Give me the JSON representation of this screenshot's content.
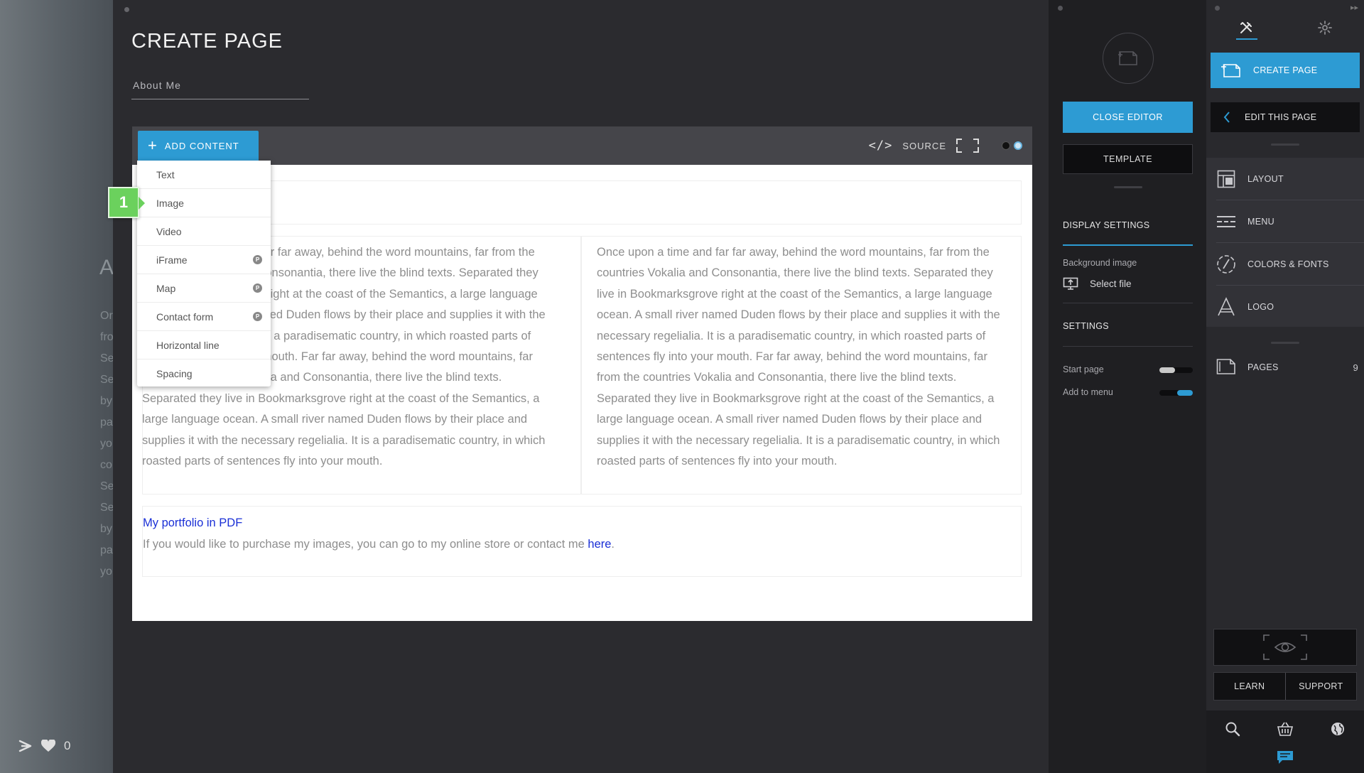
{
  "editor": {
    "page_title": "CREATE PAGE",
    "page_name_value": "About Me",
    "add_content_label": "ADD CONTENT",
    "source_label": "SOURCE",
    "dropdown": [
      {
        "label": "Text",
        "pro": false
      },
      {
        "label": "Image",
        "pro": false
      },
      {
        "label": "Video",
        "pro": false
      },
      {
        "label": "iFrame",
        "pro": true
      },
      {
        "label": "Map",
        "pro": true
      },
      {
        "label": "Contact form",
        "pro": true
      },
      {
        "label": "Horizontal line",
        "pro": false
      },
      {
        "label": "Spacing",
        "pro": false
      }
    ],
    "pro_badge": "P",
    "step_badge": "1",
    "left_column_lines": [
      "Once upon a time and far far away, behind the word mountains, far from the",
      "countries Vokalia and Consonantia, there live the blind texts. Separated they",
      "live in Bookmarksgrove right at the coast of the Semantics, a large language",
      "ocean. A small river named Duden flows by their place and supplies it with the",
      "necessary regelialia. It is a paradisematic country, in which roasted parts of",
      "sentences fly into your mouth. Far far away, behind the word mountains, far",
      "from the countries Vokalia and Consonantia, there live the blind texts.",
      "Separated they live in Bookmarksgrove right at the coast of the Semantics, a",
      "large language ocean. A small river named Duden flows by their place and",
      "supplies it with the necessary regelialia.  It is a paradisematic country, in which",
      "roasted parts of sentences fly into your mouth."
    ],
    "right_column_lines": [
      "Once upon a time and far far away, behind the word mountains, far from the",
      "countries Vokalia and Consonantia, there live the blind texts. Separated they",
      "live in Bookmarksgrove right at the coast of the Semantics, a large language",
      "ocean. A small river named Duden flows by their place and supplies it with the",
      "necessary regelialia. It is a paradisematic country, in which roasted parts of",
      "sentences fly into your mouth. Far far away, behind the word mountains, far",
      "from the countries Vokalia and Consonantia, there live the blind texts.",
      "Separated they live in Bookmarksgrove right at the coast of the Semantics, a",
      "large language ocean. A small river named Duden flows by their place and",
      "supplies it with the necessary regelialia.  It is a paradisematic country, in which",
      "roasted parts of sentences fly into your mouth."
    ],
    "portfolio_link": "My portfolio in PDF",
    "purchase_text": "If you would like to purchase my images, you can go to my online store or contact me ",
    "purchase_link": "here",
    "purchase_end": "."
  },
  "backdrop": {
    "heading_letter": "A",
    "line_fragments": [
      "Or",
      "fro",
      "Se",
      "Se",
      "by",
      "pa",
      "yo",
      "co",
      "Se",
      "Se",
      "by",
      "pa",
      "yo"
    ],
    "like_count": "0"
  },
  "settings_panel": {
    "close_editor_label": "CLOSE EDITOR",
    "template_label": "TEMPLATE",
    "display_settings_label": "DISPLAY SETTINGS",
    "background_image_label": "Background image",
    "select_file_label": "Select file",
    "settings_label": "SETTINGS",
    "start_page_label": "Start page",
    "start_page_on": false,
    "add_to_menu_label": "Add to menu",
    "add_to_menu_on": true
  },
  "nav_panel": {
    "create_page_label": "CREATE PAGE",
    "edit_page_label": "EDIT THIS PAGE",
    "items": [
      {
        "label": "LAYOUT",
        "icon": "layout-icon"
      },
      {
        "label": "MENU",
        "icon": "menu-icon"
      },
      {
        "label": "COLORS & FONTS",
        "icon": "colors-fonts-icon"
      },
      {
        "label": "LOGO",
        "icon": "logo-icon"
      }
    ],
    "pages_label": "PAGES",
    "pages_count": "9",
    "learn_label": "LEARN",
    "support_label": "SUPPORT"
  },
  "colors": {
    "accent": "#2d9bd3",
    "step_badge": "#6bd15d",
    "link": "#1a2fd6"
  }
}
